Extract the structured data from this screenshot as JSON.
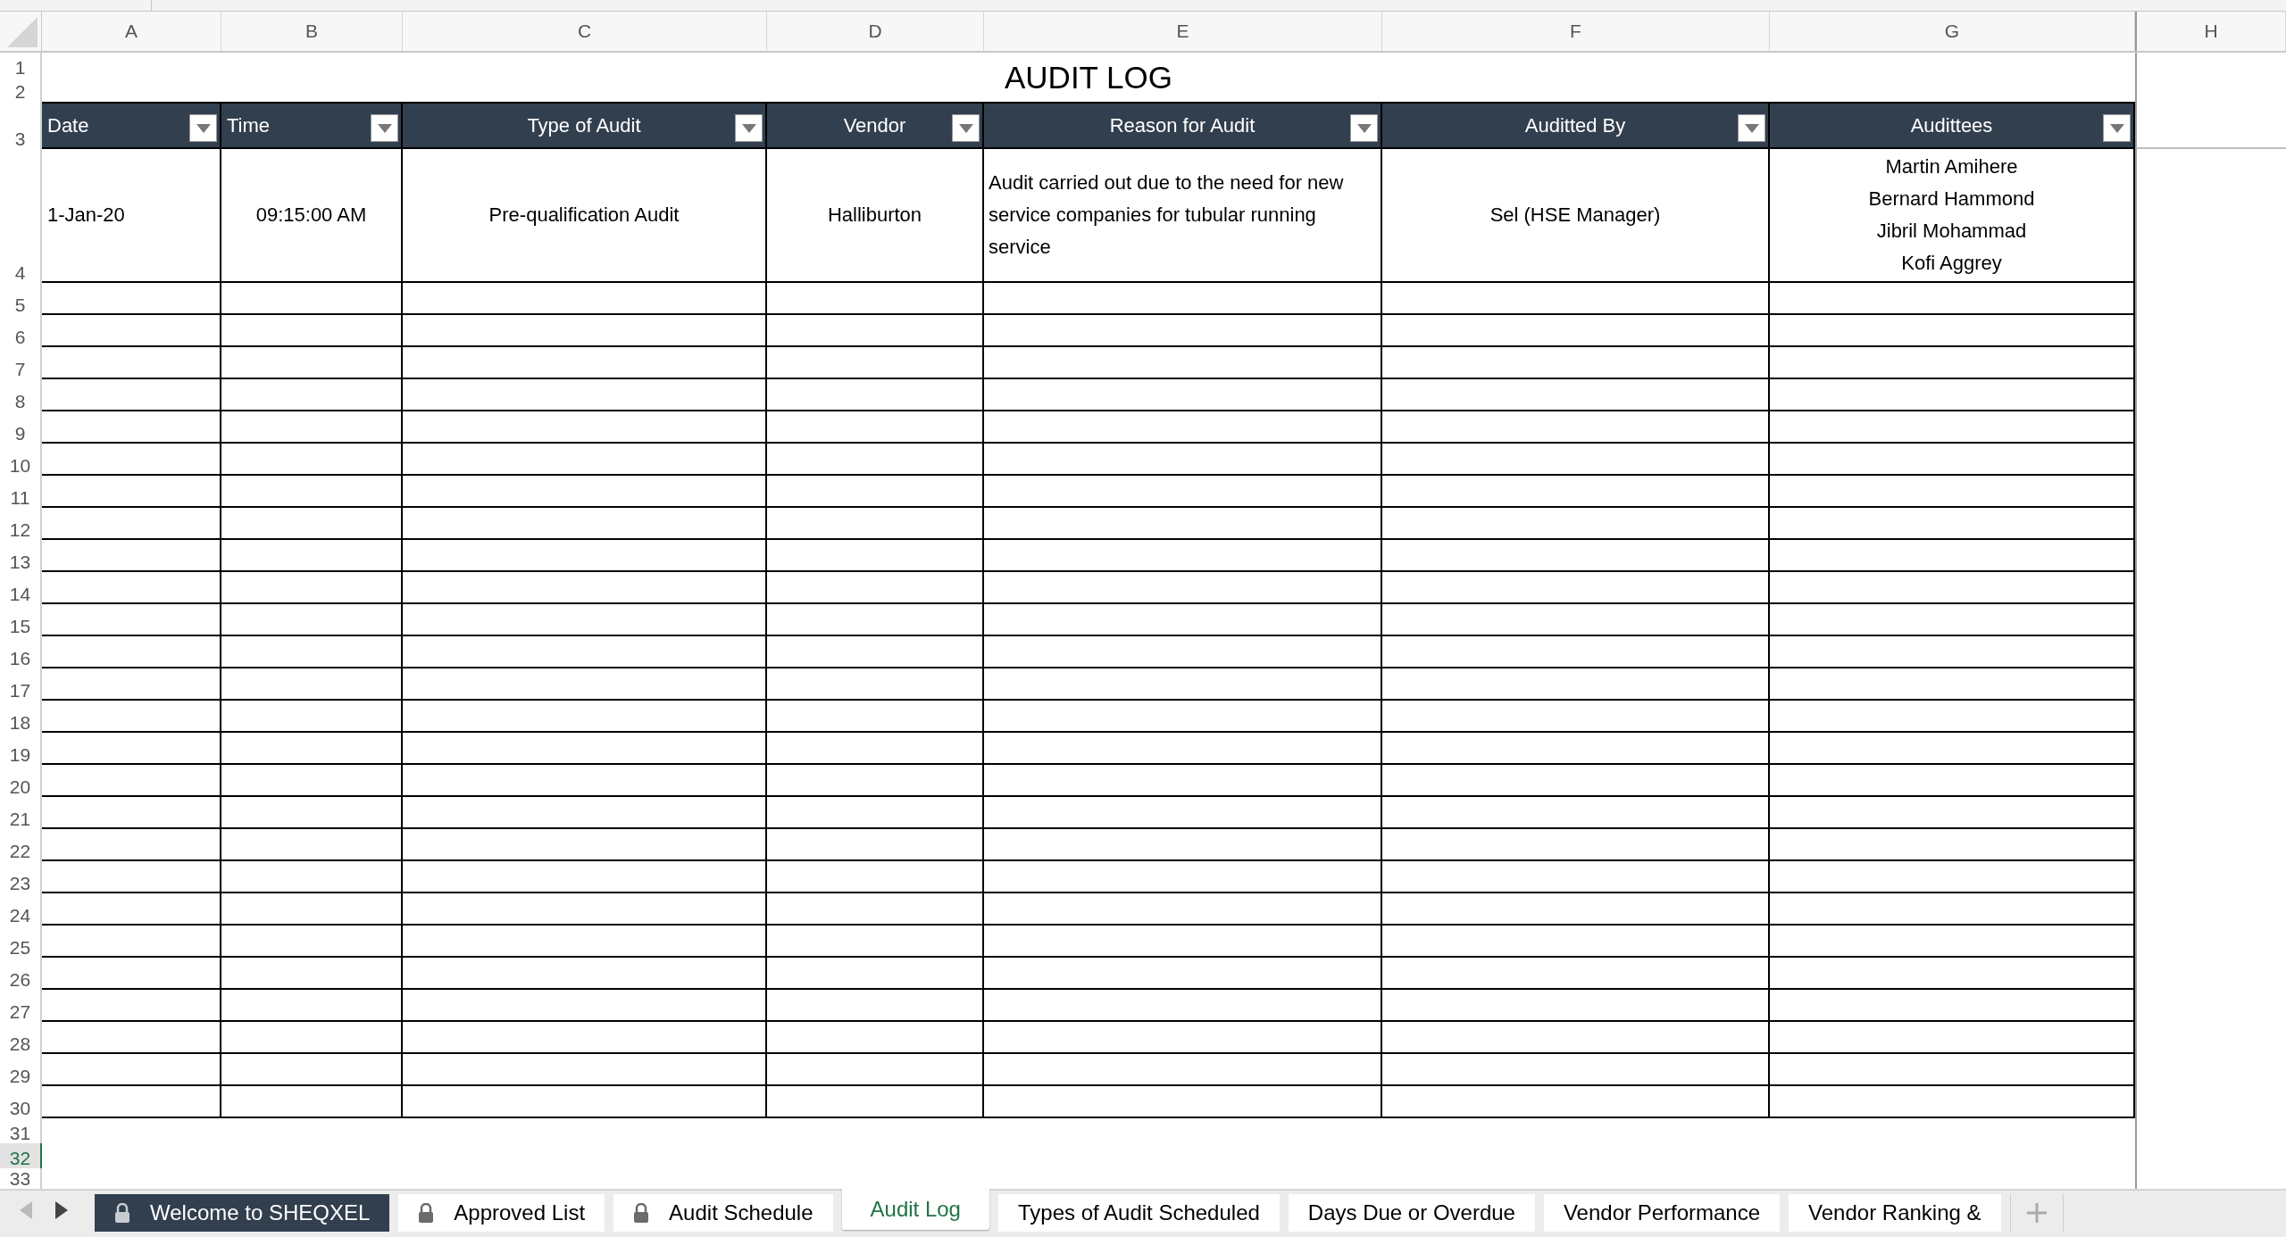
{
  "column_letters": [
    "A",
    "B",
    "C",
    "D",
    "E",
    "F",
    "G",
    "H"
  ],
  "title": "AUDIT LOG",
  "row_numbers": [
    {
      "label": "1",
      "selected": false
    },
    {
      "label": "2",
      "selected": false
    },
    {
      "label": "3",
      "selected": false
    },
    {
      "label": "4",
      "selected": false
    },
    {
      "label": "5",
      "selected": false
    },
    {
      "label": "6",
      "selected": false
    },
    {
      "label": "7",
      "selected": false
    },
    {
      "label": "8",
      "selected": false
    },
    {
      "label": "9",
      "selected": false
    },
    {
      "label": "10",
      "selected": false
    },
    {
      "label": "11",
      "selected": false
    },
    {
      "label": "12",
      "selected": false
    },
    {
      "label": "13",
      "selected": false
    },
    {
      "label": "14",
      "selected": false
    },
    {
      "label": "15",
      "selected": false
    },
    {
      "label": "16",
      "selected": false
    },
    {
      "label": "17",
      "selected": false
    },
    {
      "label": "18",
      "selected": false
    },
    {
      "label": "19",
      "selected": false
    },
    {
      "label": "20",
      "selected": false
    },
    {
      "label": "21",
      "selected": false
    },
    {
      "label": "22",
      "selected": false
    },
    {
      "label": "23",
      "selected": false
    },
    {
      "label": "24",
      "selected": false
    },
    {
      "label": "25",
      "selected": false
    },
    {
      "label": "26",
      "selected": false
    },
    {
      "label": "27",
      "selected": false
    },
    {
      "label": "28",
      "selected": false
    },
    {
      "label": "29",
      "selected": false
    },
    {
      "label": "30",
      "selected": false
    },
    {
      "label": "31",
      "selected": false
    },
    {
      "label": "32",
      "selected": true
    },
    {
      "label": "33",
      "selected": false
    }
  ],
  "table": {
    "columns": [
      "Date",
      "Time",
      "Type of Audit",
      "Vendor",
      "Reason for Audit",
      "Auditted By",
      "Audittees"
    ],
    "rows": [
      {
        "cells": [
          [
            "1-Jan-20"
          ],
          [
            "09:15:00 AM"
          ],
          [
            "Pre-qualification Audit"
          ],
          [
            "Halliburton"
          ],
          [
            "Audit carried out due to the need for new service companies for tubular running service"
          ],
          [
            "Sel (HSE Manager)"
          ],
          [
            "Martin Amihere",
            "Bernard Hammond",
            "Jibril Mohammad",
            "Kofi Aggrey"
          ]
        ]
      }
    ]
  },
  "sheet_tabs": [
    {
      "label": "Welcome to SHEQXEL",
      "locked": true,
      "selected": false,
      "color": "#323f4f"
    },
    {
      "label": "Approved List",
      "locked": true,
      "selected": false
    },
    {
      "label": "Audit Schedule",
      "locked": true,
      "selected": false
    },
    {
      "label": "Audit Log",
      "locked": false,
      "selected": true
    },
    {
      "label": "Types of Audit Scheduled",
      "locked": false,
      "selected": false
    },
    {
      "label": "Days Due or Overdue",
      "locked": false,
      "selected": false
    },
    {
      "label": "Vendor Performance",
      "locked": false,
      "selected": false
    },
    {
      "label": "Vendor Ranking &",
      "locked": false,
      "selected": false
    }
  ]
}
